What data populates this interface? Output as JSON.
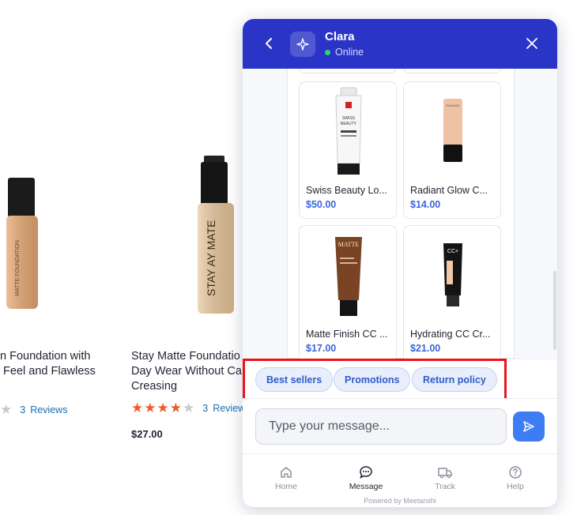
{
  "store": {
    "products": [
      {
        "title": "n Foundation with\n Feel and Flawless",
        "review_count": "3",
        "reviews_label": "Reviews",
        "rating": 0.2
      },
      {
        "title": "Stay Matte Foundatio\nDay Wear Without Ca\nCreasing",
        "review_count": "3",
        "reviews_label": "Reviews",
        "rating": 4.5,
        "price": "$27.00",
        "bottle_text": "STAY AY  MATE"
      }
    ]
  },
  "chat": {
    "agent_name": "Clara",
    "status": "Online",
    "products": [
      {
        "name": "Swiss Beauty Lo...",
        "price": "$50.00",
        "image": "white-tube"
      },
      {
        "name": "Radiant Glow C...",
        "price": "$14.00",
        "image": "beige-bottle"
      },
      {
        "name": "Matte Finish CC ...",
        "price": "$17.00",
        "image": "brown-tube",
        "label": "MATTE"
      },
      {
        "name": "Hydrating CC Cr...",
        "price": "$21.00",
        "image": "black-tube",
        "label": "CC+"
      }
    ],
    "quick_replies": [
      "Best sellers",
      "Promotions",
      "Return policy"
    ],
    "input_placeholder": "Type your message...",
    "nav": [
      {
        "label": "Home",
        "icon": "home-icon"
      },
      {
        "label": "Message",
        "icon": "message-icon"
      },
      {
        "label": "Track",
        "icon": "truck-icon"
      },
      {
        "label": "Help",
        "icon": "help-icon"
      }
    ],
    "powered_by": "Powered by Meetanshi"
  },
  "colors": {
    "header": "#2a35c8",
    "accent": "#3d7cf2",
    "chip_text": "#2f5cc8",
    "highlight": "#e8141b",
    "star": "#f05a28"
  }
}
